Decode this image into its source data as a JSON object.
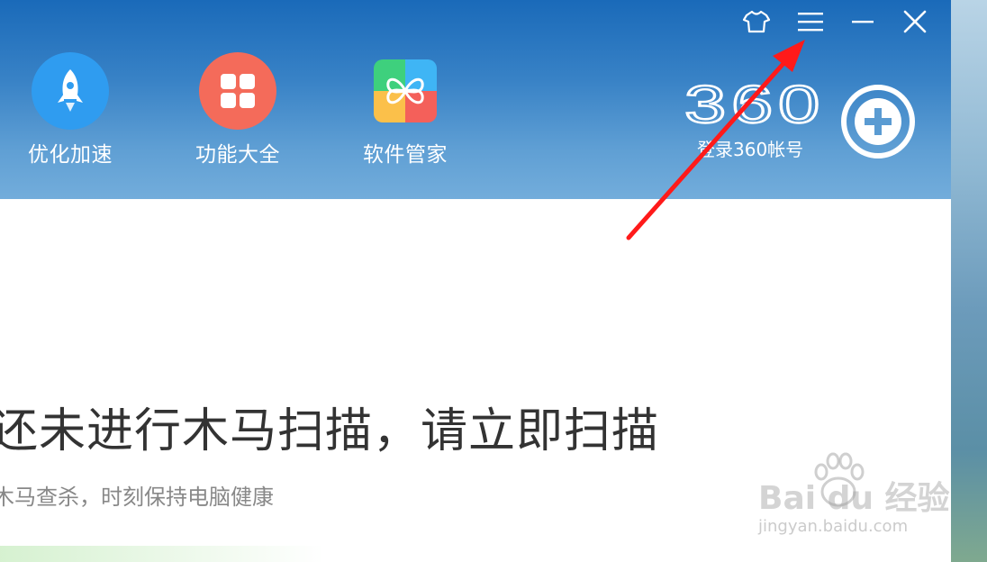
{
  "window_controls": {
    "skin_icon": "tshirt-icon",
    "menu_icon": "hamburger-menu-icon",
    "minimize_icon": "minimize-icon",
    "close_icon": "close-icon"
  },
  "toolbar": {
    "items": [
      {
        "label": "优化加速",
        "icon": "rocket-icon",
        "color": "#2f9cf0"
      },
      {
        "label": "功能大全",
        "icon": "grid-icon",
        "color": "#f46b5a"
      },
      {
        "label": "软件管家",
        "icon": "software-manager-icon",
        "color": "#3fb5f5"
      }
    ]
  },
  "account": {
    "logo_text": "360",
    "login_label": "登录360帐号",
    "login_icon": "360-guard-icon"
  },
  "status": {
    "title": "还未进行木马扫描，请立即扫描",
    "subtitle": "木马查杀，时刻保持电脑健康"
  },
  "watermark": {
    "brand": "Bai  du 经验",
    "url": "jingyan.baidu.com"
  },
  "colors": {
    "header_top": "#1a6ab9",
    "header_bottom": "#73addb",
    "annotation_arrow": "#ff1a1a"
  }
}
